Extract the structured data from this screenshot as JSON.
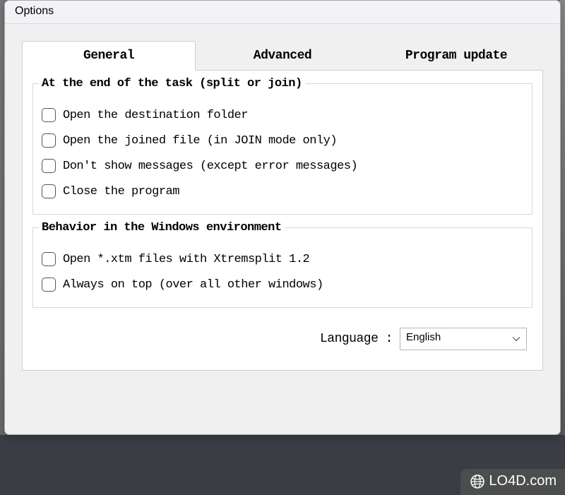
{
  "window": {
    "title": "Options"
  },
  "tabs": {
    "general": "General",
    "advanced": "Advanced",
    "update": "Program update"
  },
  "group1": {
    "title": "At the end of the task (split or join)",
    "items": [
      "Open the destination folder",
      "Open the joined file (in JOIN mode only)",
      "Don't show messages (except error messages)",
      "Close the program"
    ]
  },
  "group2": {
    "title": "Behavior in the Windows environment",
    "items": [
      "Open *.xtm files with Xtremsplit 1.2",
      "Always on top (over all other windows)"
    ]
  },
  "language": {
    "label": "Language :",
    "value": "English"
  },
  "watermark": {
    "text": "LO4D.com"
  }
}
